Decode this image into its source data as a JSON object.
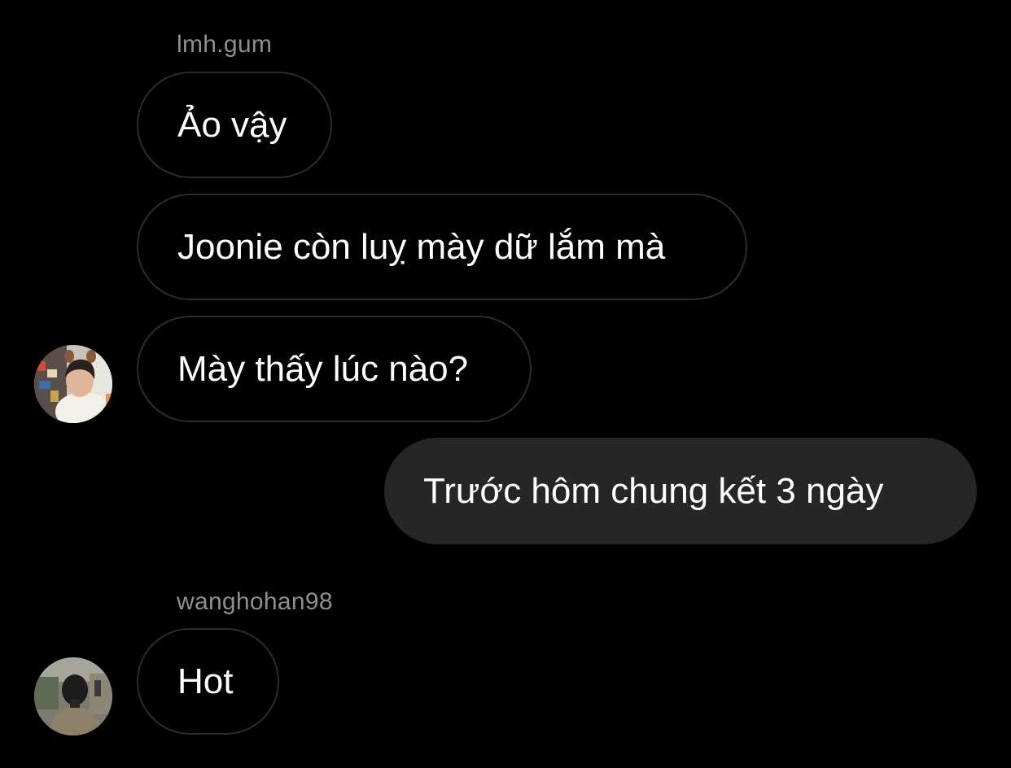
{
  "thread": {
    "groups": [
      {
        "sender": "lmh.gum",
        "messages": [
          "Ảo vậy",
          "Joonie còn luỵ mày dữ lắm mà",
          "Mày thấy lúc nào?"
        ],
        "avatar": "avatar-photo-lmh-gum"
      },
      {
        "sender": "me",
        "messages": [
          "Trước hôm chung kết 3 ngày"
        ]
      },
      {
        "sender": "wanghohan98",
        "messages": [
          "Hot"
        ],
        "avatar": "avatar-photo-wanghohan98"
      }
    ]
  },
  "colors": {
    "background": "#000000",
    "incoming_border": "#2c2c2e",
    "outgoing_bubble": "#262626",
    "sender_name": "#8e8e93",
    "text": "#ffffff"
  }
}
